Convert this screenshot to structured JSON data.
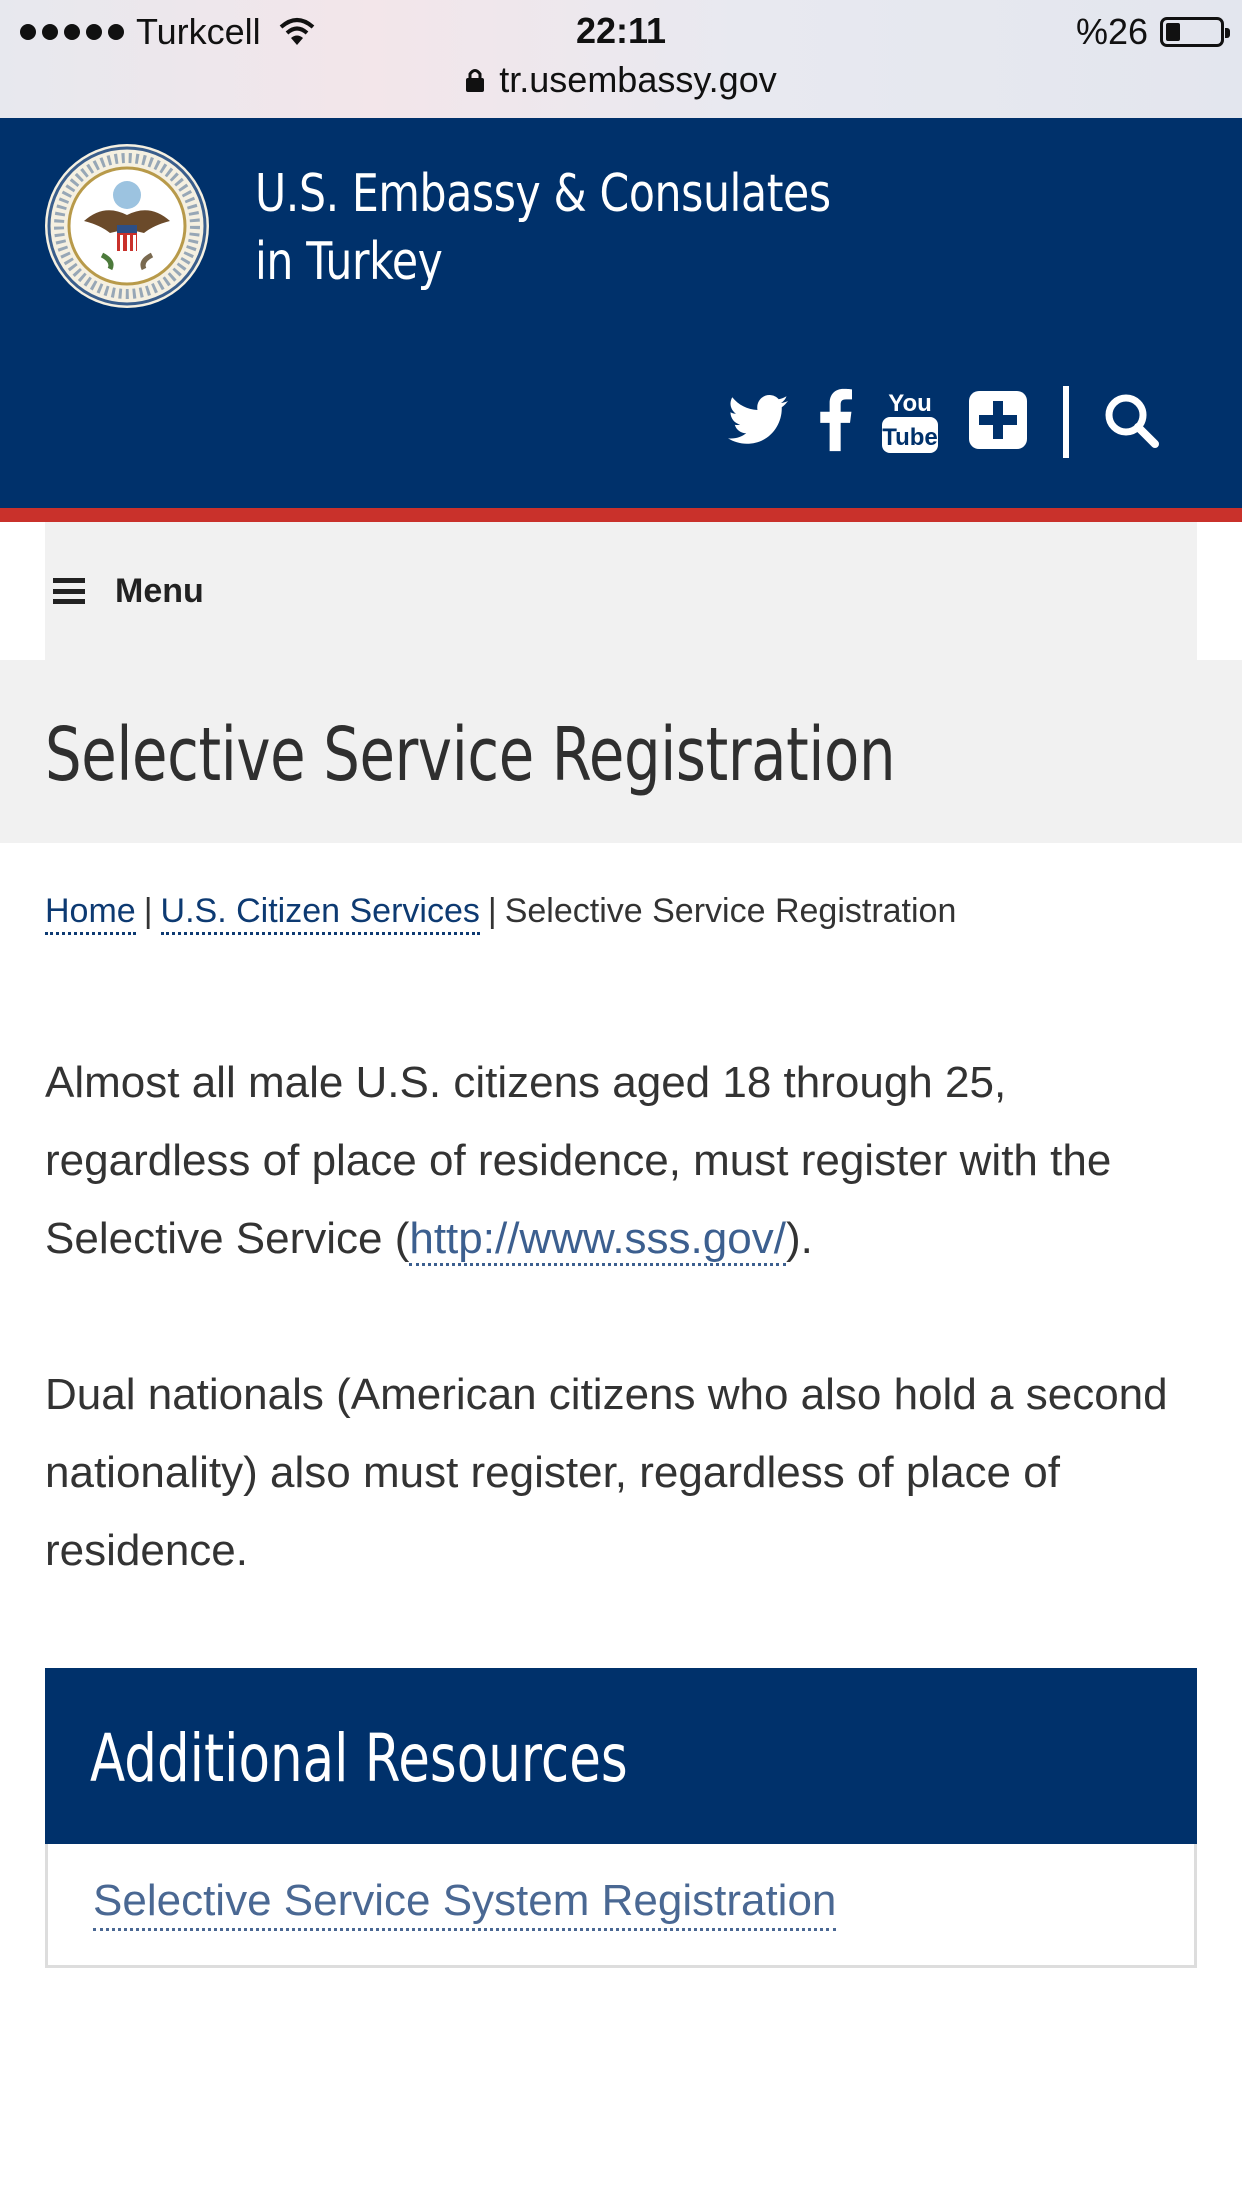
{
  "status_bar": {
    "carrier": "Turkcell",
    "time": "22:11",
    "battery": "%26",
    "battery_level": 0.26,
    "url": "tr.usembassy.gov"
  },
  "header": {
    "title_line1": "U.S. Embassy & Consulates",
    "title_line2": "in Turkey",
    "social_icons": [
      "twitter-icon",
      "facebook-icon",
      "youtube-icon",
      "plus-icon"
    ],
    "colors": {
      "navy": "#00316b",
      "red": "#c9312b"
    }
  },
  "menu": {
    "label": "Menu"
  },
  "page": {
    "title": "Selective Service Registration"
  },
  "breadcrumb": {
    "items": [
      "Home",
      "U.S. Citizen Services",
      "Selective Service Registration"
    ],
    "separator": "|"
  },
  "content": {
    "para1_text": "Almost all male U.S. citizens aged 18 through 25, regardless of place of residence, must register with the Selective Service (",
    "para1_link": "http://www.sss.gov/",
    "para1_end": ").",
    "para2": "Dual nationals (American citizens who also hold a second nationality) also must register, regardless of place of residence."
  },
  "resources": {
    "title": "Additional Resources",
    "links": [
      "Selective Service System Registration"
    ]
  }
}
